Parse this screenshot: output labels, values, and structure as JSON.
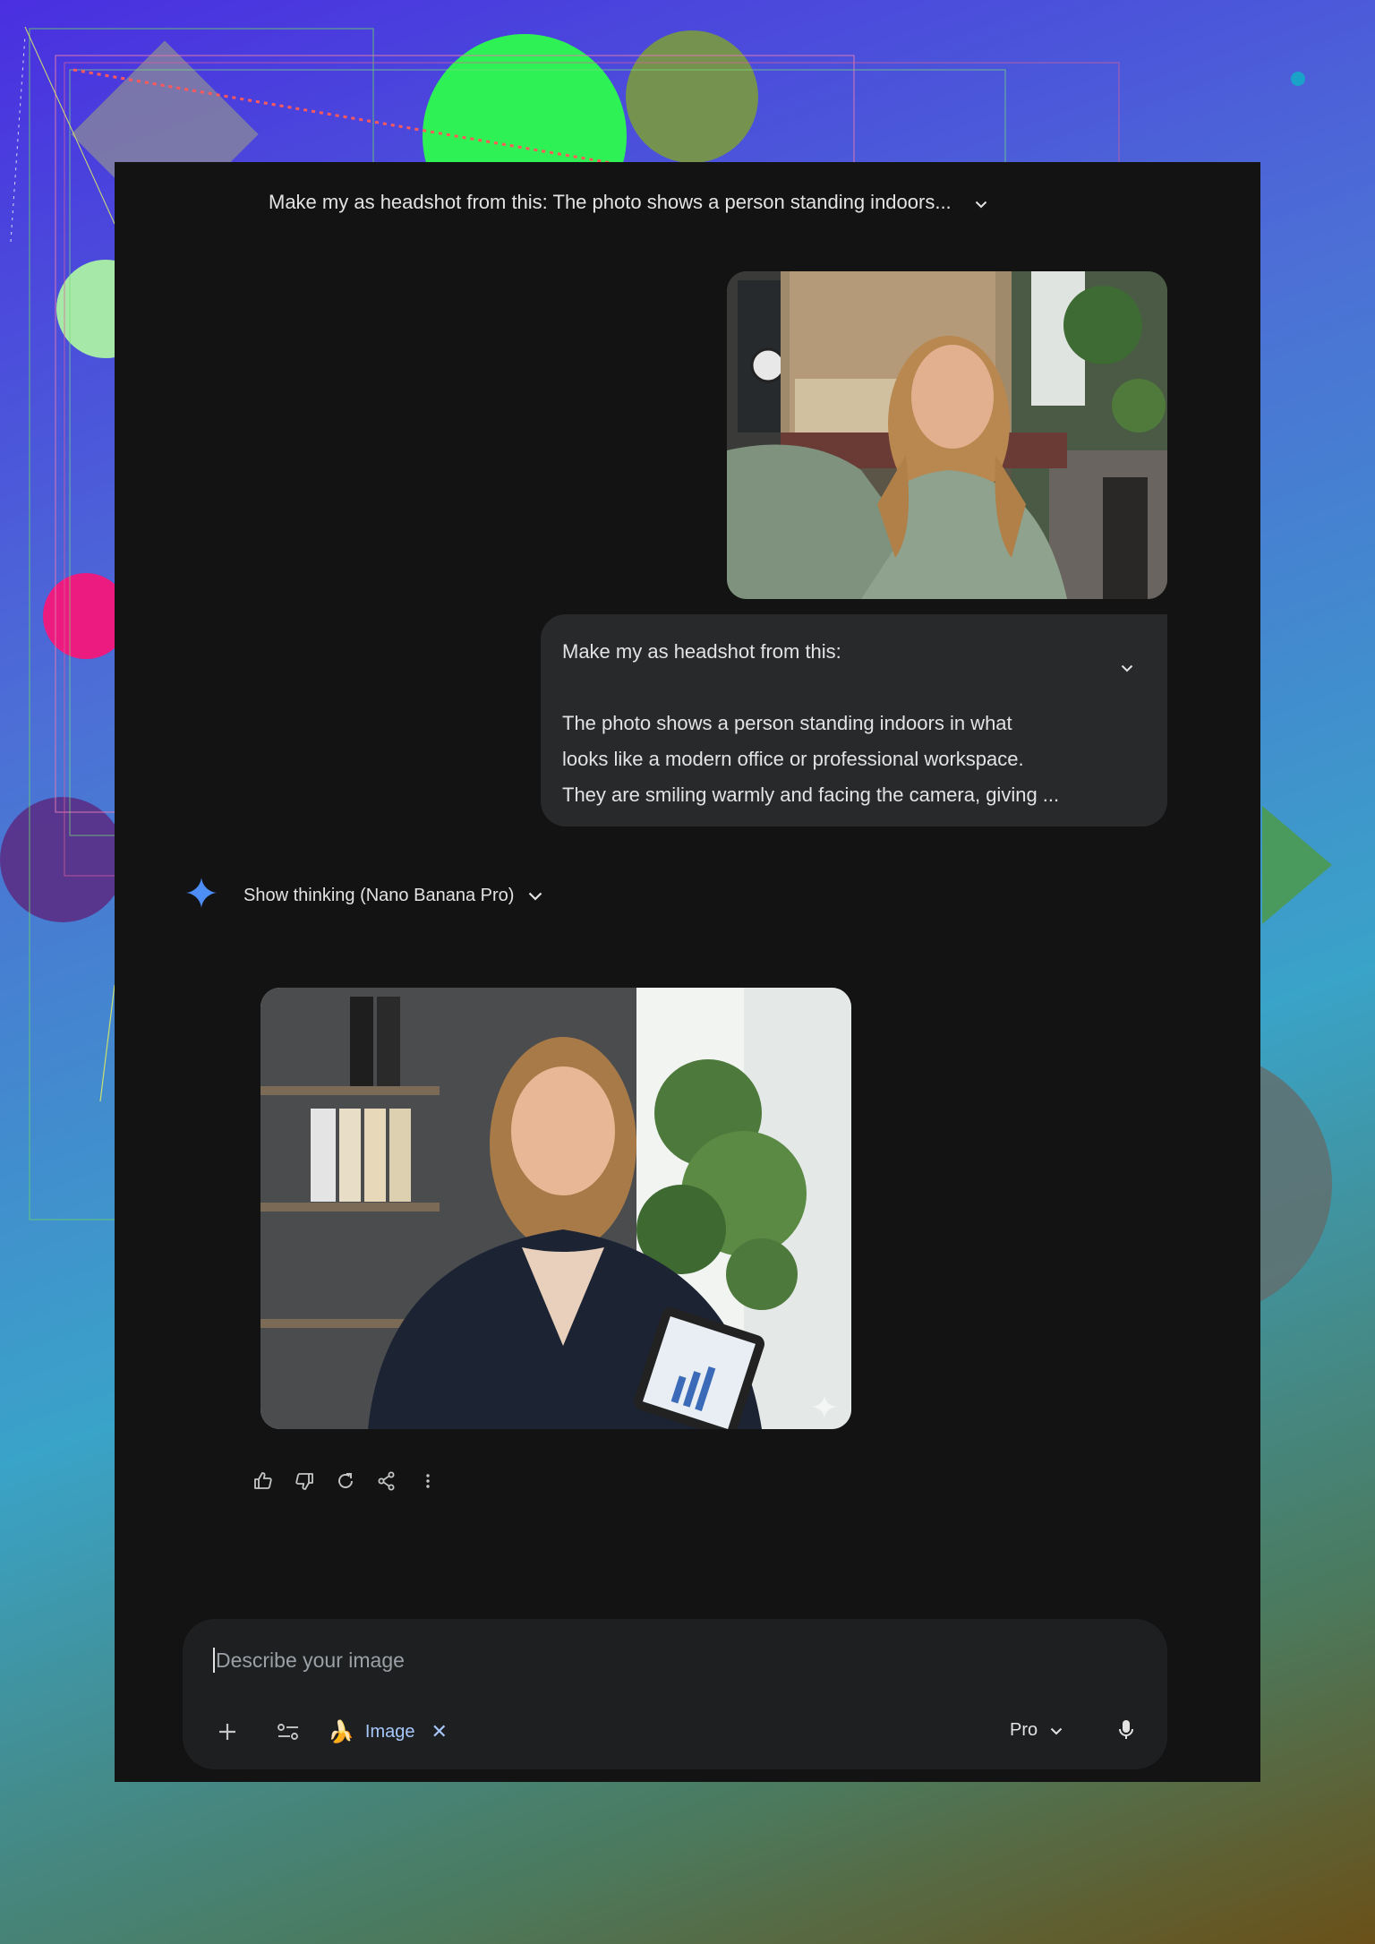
{
  "conversation": {
    "title": "Make my as headshot from this: The photo shows a person standing indoors..."
  },
  "user_message": {
    "line1": "Make my as headshot from this:",
    "paragraph": [
      "The photo shows a person standing indoors in what",
      "looks like a modern office or professional workspace.",
      "They are smiling warmly and facing the camera, giving ..."
    ],
    "attachment_icon": "user-uploaded-photo"
  },
  "response": {
    "thinking_label": "Show thinking (Nano Banana Pro)",
    "image_icon": "generated-headshot-image",
    "actions": [
      "thumbs-up-icon",
      "thumbs-down-icon",
      "regenerate-icon",
      "share-icon",
      "more-options-icon"
    ]
  },
  "composer": {
    "placeholder": "Describe your image",
    "tool_chip_label": "Image",
    "tool_chip_emoji": "🍌",
    "close_glyph": "✕",
    "model_label": "Pro"
  },
  "colors": {
    "app_background": "#131314",
    "bubble_background": "#28292b",
    "composer_background": "#1e1f20",
    "accent_blue": "#4c8df6",
    "chip_blue": "#a8c7fa"
  }
}
